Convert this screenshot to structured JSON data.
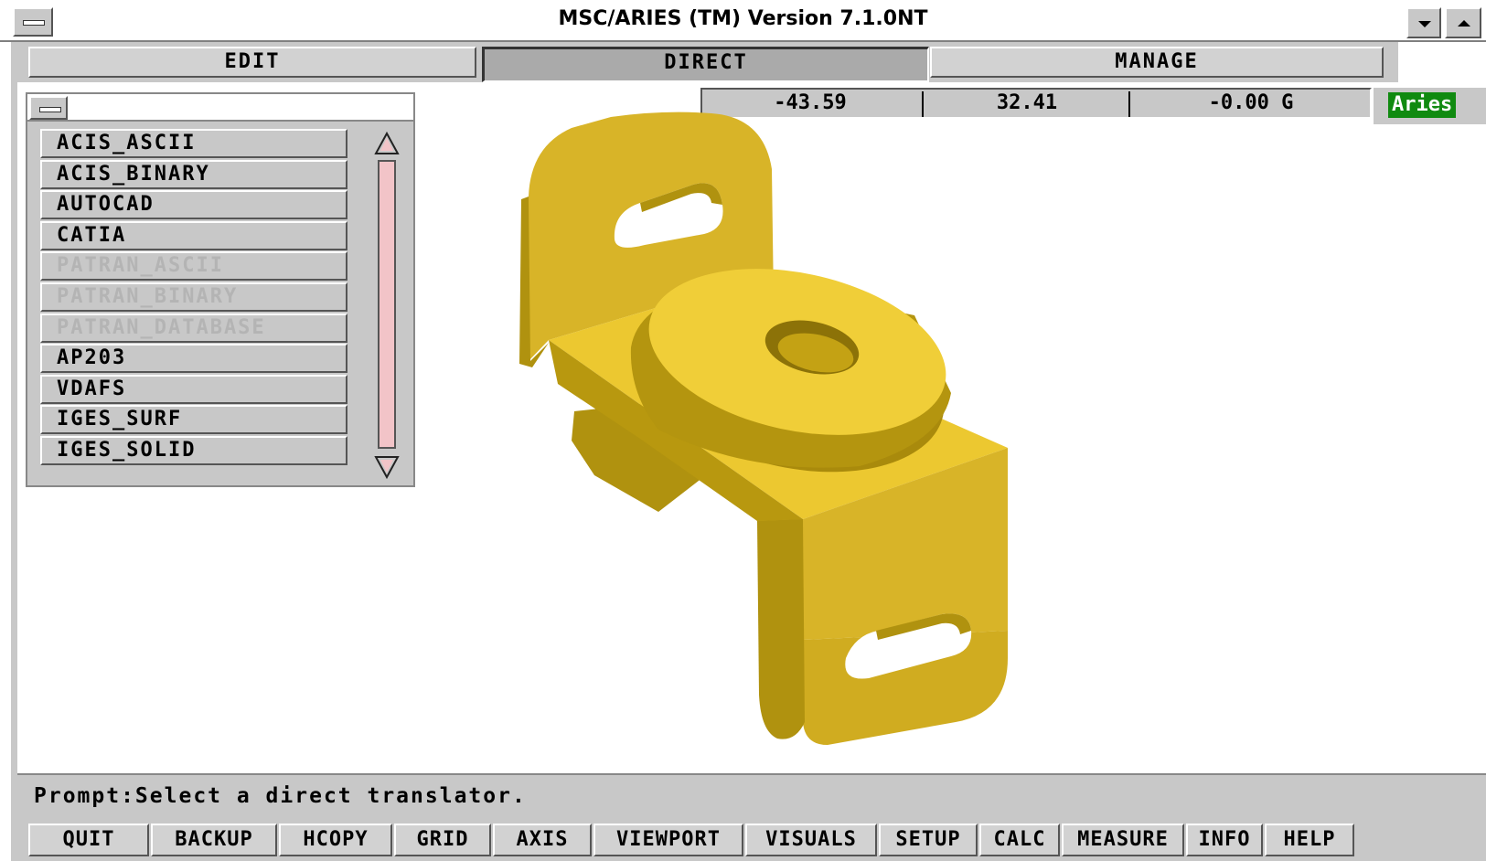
{
  "window": {
    "title": "MSC/ARIES (TM) Version 7.1.0NT"
  },
  "modes": [
    {
      "label": "EDIT"
    },
    {
      "label": "DIRECT"
    },
    {
      "label": "MANAGE"
    }
  ],
  "coordinates": {
    "x": "-43.59",
    "y": "32.41",
    "z": "-0.00 G"
  },
  "badge": "Aries",
  "translators": {
    "items": [
      {
        "label": "ACIS_ASCII",
        "enabled": true
      },
      {
        "label": "ACIS_BINARY",
        "enabled": true
      },
      {
        "label": "AUTOCAD",
        "enabled": true
      },
      {
        "label": "CATIA",
        "enabled": true
      },
      {
        "label": "PATRAN_ASCII",
        "enabled": false
      },
      {
        "label": "PATRAN_BINARY",
        "enabled": false
      },
      {
        "label": "PATRAN_DATABASE",
        "enabled": false
      },
      {
        "label": "AP203",
        "enabled": true
      },
      {
        "label": "VDAFS",
        "enabled": true
      },
      {
        "label": "IGES_SURF",
        "enabled": true
      },
      {
        "label": "IGES_SOLID",
        "enabled": true
      }
    ]
  },
  "prompt": "Prompt:Select a direct translator.",
  "commands": [
    {
      "label": "QUIT"
    },
    {
      "label": "BACKUP"
    },
    {
      "label": "HCOPY"
    },
    {
      "label": "GRID"
    },
    {
      "label": "AXIS"
    },
    {
      "label": "VIEWPORT"
    },
    {
      "label": "VISUALS"
    },
    {
      "label": "SETUP"
    },
    {
      "label": "CALC"
    },
    {
      "label": "MEASURE"
    },
    {
      "label": "INFO"
    },
    {
      "label": "HELP"
    }
  ],
  "colors": {
    "model_light": "#e8c428",
    "model_mid": "#d8b428",
    "model_dark": "#b0920f",
    "badge_green": "#108a10"
  }
}
